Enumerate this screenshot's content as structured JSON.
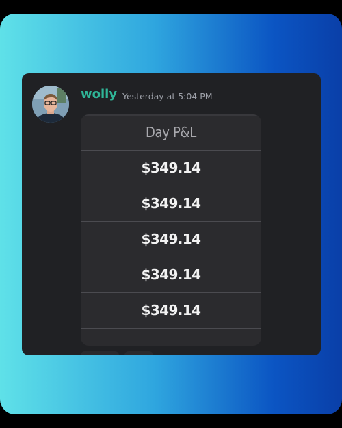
{
  "message": {
    "author": "wolly",
    "timestamp": "Yesterday at 5:04 PM",
    "author_color": "#2fb597"
  },
  "table": {
    "header": "Day P&L",
    "rows": [
      "$349.14",
      "$349.14",
      "$349.14",
      "$349.14",
      "$349.14"
    ]
  },
  "colors": {
    "background_gradient_start": "#5fe1e8",
    "background_gradient_end": "#0a3fa8",
    "card_background": "#202124"
  }
}
